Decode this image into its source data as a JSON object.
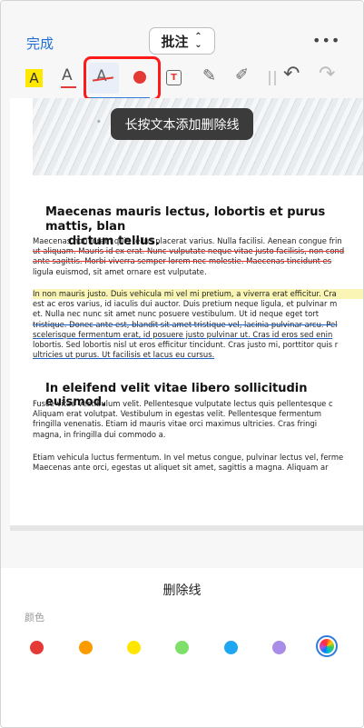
{
  "topbar": {
    "done_label": "完成",
    "mode_label": "批注",
    "mode_chevron": "⌃⌄",
    "more_label": "•••"
  },
  "toolbar": {
    "highlight_icon": "A",
    "underline_icon": "A",
    "strike_icon": "A",
    "textbox_icon": "T",
    "pencil_icon": "✎",
    "marker_icon": "✐",
    "undo_icon": "↶",
    "redo_icon": "↷"
  },
  "tooltip": {
    "text": "长按文本添加删除线"
  },
  "document": {
    "heading1_line1": "Maecenas mauris lectus, lobortis et purus mattis, blan",
    "heading1_line2": "dictum tellus.",
    "para1": [
      "Maecenas non lorem quis tellus placerat varius. Nulla facilisi. Aenean congue frin",
      "ut aliquam. Mauris id ex erat. Nunc vulputate neque vitae justo facilisis, non cond",
      "ante sagittis. Morbi viverra semper lorem nec molestie. Maecenas tincidunt es",
      "ligula euismod, sit amet ornare est vulputate."
    ],
    "para2": [
      "In non mauris justo. Duis vehicula mi vel mi pretium, a viverra erat efficitur. Cra",
      "est ac eros varius, id iaculis dui auctor. Duis pretium neque ligula, et pulvinar m",
      "et. Nulla nec nunc sit amet nunc posuere vestibulum. Ut id neque eget tort",
      "tristique. Donec ante est, blandit sit amet tristique vel, lacinia pulvinar arcu. Pel",
      "scelerisque fermentum erat, id posuere justo pulvinar ut. Cras id eros sed enin",
      "lobortis. Sed lobortis nisl ut eros efficitur tincidunt. Cras justo mi, porttitor quis r",
      "ultricies ut purus. Ut facilisis et lacus eu cursus."
    ],
    "heading2": "In eleifend velit vitae libero sollicitudin euismod.",
    "para3": [
      "Fusce vitae vestibulum velit. Pellentesque vulputate lectus quis pellentesque c",
      "Aliquam erat volutpat. Vestibulum in egestas velit. Pellentesque fermentum",
      "fringilla venenatis. Etiam id mauris vitae orci maximus ultricies. Cras fringi",
      "magna, in fringilla dui commodo a."
    ],
    "para4": [
      "Etiam vehicula luctus fermentum. In vel metus congue, pulvinar lectus vel, ferme",
      "Maecenas ante orci, egestas ut aliquet sit amet, sagittis a magna. Aliquam ar"
    ]
  },
  "panel": {
    "title": "删除线",
    "color_label": "颜色",
    "colors": [
      "#e53935",
      "#fb9b00",
      "#ffe600",
      "#7ee06a",
      "#1ea7f0",
      "#a98be8"
    ]
  }
}
